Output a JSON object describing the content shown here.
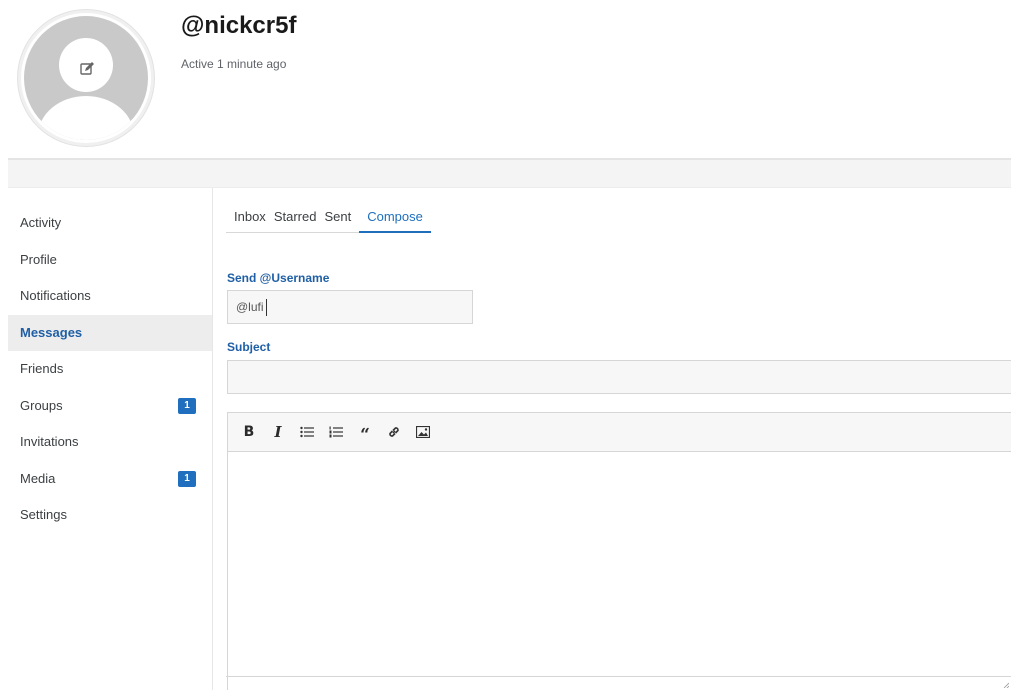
{
  "profile": {
    "username": "@nickcr5f",
    "status": "Active 1 minute ago",
    "avatar_edit_icon": "edit-icon"
  },
  "sidebar": {
    "items": [
      {
        "label": "Activity"
      },
      {
        "label": "Profile"
      },
      {
        "label": "Notifications"
      },
      {
        "label": "Messages",
        "active": true
      },
      {
        "label": "Friends"
      },
      {
        "label": "Groups",
        "badge": "1"
      },
      {
        "label": "Invitations"
      },
      {
        "label": "Media",
        "badge": "1"
      },
      {
        "label": "Settings"
      }
    ]
  },
  "tabs": [
    {
      "label": "Inbox"
    },
    {
      "label": "Starred"
    },
    {
      "label": "Sent"
    },
    {
      "label": "Compose",
      "active": true
    }
  ],
  "compose": {
    "send_label": "Send @Username",
    "username_value": "@lufi",
    "subject_label": "Subject",
    "subject_value": ""
  },
  "toolbar": {
    "bold_label": "B",
    "italic_label": "I",
    "quote_label": "“",
    "icons": [
      "bold-icon",
      "italic-icon",
      "bullet-list-icon",
      "numbered-list-icon",
      "quote-icon",
      "link-icon",
      "image-icon"
    ]
  },
  "colors": {
    "accent": "#1f6fbe",
    "label_blue": "#1f5fa6",
    "badge": "#1f6fbe"
  }
}
